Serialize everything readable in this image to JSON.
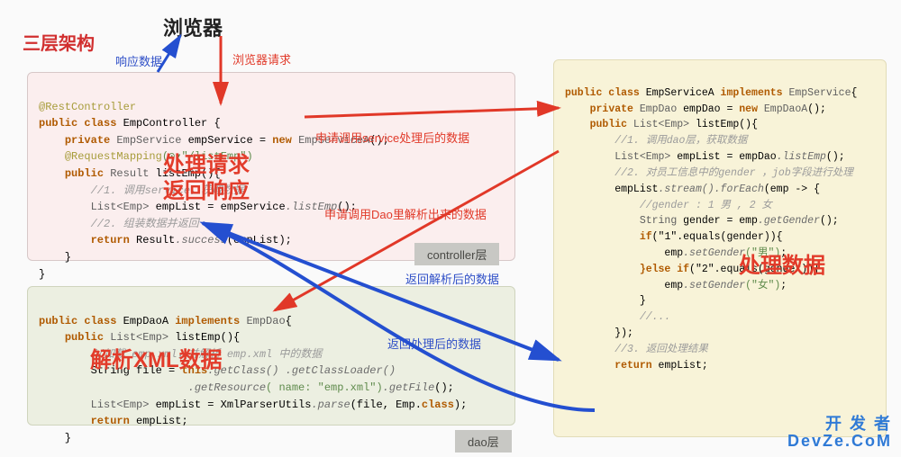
{
  "title_main": "三层架构",
  "title_browser": "浏览器",
  "labels": {
    "resp_data": "响应数据",
    "browser_req": "浏览器请求",
    "handle_req": "处理请求",
    "return_resp": "返回响应",
    "call_service": "申请调用service处理后的数据",
    "call_dao": "申请调用Dao里解析出来的数据",
    "return_parsed": "返回解析后的数据",
    "return_processed": "返回处理后的数据",
    "process_data": "处理数据",
    "parse_xml": "解析XML数据",
    "controller_layer": "controller层",
    "dao_layer": "dao层"
  },
  "watermark": {
    "line1": "开 发 者",
    "line2": "DevZe.CoM"
  },
  "controller": {
    "l1_anno": "@RestController",
    "l2": {
      "kw1": "public class",
      "name": " EmpController {"
    },
    "l3": {
      "kw1": "private",
      "t1": " EmpService",
      "var": " empService",
      "eq": " = ",
      "kw2": "new",
      "t2": " EmpServiceA",
      "end": "();"
    },
    "l4": {
      "anno": "@RequestMapping",
      "param": "(⊙▾\"/listEmp\")"
    },
    "l5": {
      "kw1": "public",
      "t1": " Result",
      "name": " listEmp(){ "
    },
    "l6": "//1. 调用service，获取数据",
    "l7": {
      "t1": "List<Emp>",
      "var": " empList",
      "eq": " = ",
      "obj": "empService",
      "call": ".listEmp",
      "end": "();"
    },
    "l8": "//2. 组装数据并返回",
    "l9": {
      "kw": "return",
      "obj": " Result",
      "call": ".success",
      "arg": "(empList)",
      "end": ";"
    },
    "close1": "    }",
    "close2": "}"
  },
  "dao": {
    "l1": {
      "kw1": "public class",
      "name": " EmpDaoA ",
      "kw2": "implements",
      "t": " EmpDao",
      "end": "{"
    },
    "l2": {
      "kw1": "public",
      "t1": " List<Emp>",
      "name": " listEmp",
      "end": "(){"
    },
    "l3": "//加载 emp.xml，并解析 emp.xml 中的数据",
    "l4": {
      "v": "String file = ",
      "kw": "this",
      "call1": ".getClass()",
      "call2": " .getClassLoader()"
    },
    "l5": {
      "call": "                       .getResource",
      "arg": "( name: \"emp.xml\")",
      "call2": ".getFile",
      "end": "();"
    },
    "l6": {
      "t1": "List<Emp>",
      "var": " empList = ",
      "obj": "XmlParserUtils",
      "call": ".parse",
      "arg": "(file, Emp.",
      "kw": "class",
      "end": ");"
    },
    "l7": {
      "kw": "return",
      "var": " empList",
      "end": ";"
    },
    "close": "    }"
  },
  "service": {
    "l1": {
      "kw1": "public class",
      "name": " EmpServiceA ",
      "kw2": "implements",
      "t": " EmpService",
      "end": "{"
    },
    "l2": {
      "kw1": "private",
      "t1": " EmpDao",
      "var": " empDao",
      "eq": " = ",
      "kw2": "new",
      "t2": " EmpDaoA",
      "end": "();"
    },
    "l3": {
      "kw1": "public",
      "t1": " List<Emp>",
      "name": " listEmp",
      "end": "(){"
    },
    "l4": "//1. 调用dao层，获取数据",
    "l5": {
      "t1": "List<Emp>",
      "var": " empList",
      "eq": " = ",
      "obj": "empDao",
      "call": ".listEmp",
      "end": "();"
    },
    "l6": "//2. 对员工信息中的gender ，job字段进行处理",
    "l7": {
      "obj": "empList",
      "call1": ".stream()",
      "call2": ".forEach",
      "arg": "(emp -> {"
    },
    "l8": "//gender : 1 男 , 2 女",
    "l9": {
      "t": "String ",
      "var": "gender = emp",
      "call": ".getGender",
      "end": "();"
    },
    "l10": {
      "kw": "if",
      "cond": "(\"1\".equals(gender)){"
    },
    "l11": {
      "obj": "    emp",
      "call": ".setGender",
      "arg": "(\"男\")",
      "end": ";"
    },
    "l12": {
      "kw": "}else if",
      "cond": "(\"2\".equals(gender)){"
    },
    "l13": {
      "obj": "    emp",
      "call": ".setGender",
      "arg": "(\"女\")",
      "end": ";"
    },
    "l14": "}",
    "l15": "//...",
    "l16": "});",
    "l17": "//3. 返回处理结果",
    "l18": {
      "kw": "return",
      "var": " empList",
      "end": ";"
    }
  }
}
